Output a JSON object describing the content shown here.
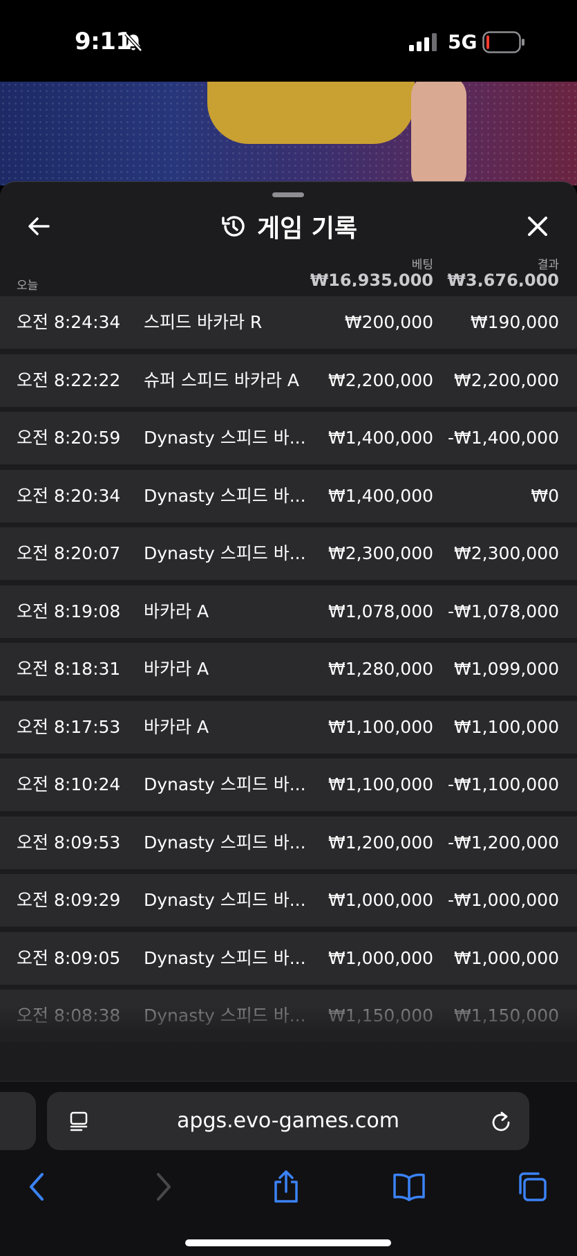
{
  "status_bar": {
    "time": "9:11",
    "network": "5G",
    "battery_level": 0.08,
    "battery_color": "#ff3b30"
  },
  "sheet": {
    "title": "게임 기록",
    "icons": {
      "back": "arrow-left-icon",
      "history": "history-clock-icon",
      "close": "close-x-icon"
    },
    "columns": {
      "bet": "베팅",
      "result": "결과"
    },
    "summary": {
      "label": "오늘",
      "total_bet": "₩16,935,000",
      "total_result": "₩3,676,000"
    },
    "rows": [
      {
        "time": "오전 8:24:34",
        "game": "스피드 바카라 R",
        "bet": "₩200,000",
        "result": "₩190,000"
      },
      {
        "time": "오전 8:22:22",
        "game": "슈퍼 스피드 바카라 A",
        "bet": "₩2,200,000",
        "result": "₩2,200,000"
      },
      {
        "time": "오전 8:20:59",
        "game": "Dynasty 스피드 바...",
        "bet": "₩1,400,000",
        "result": "-₩1,400,000"
      },
      {
        "time": "오전 8:20:34",
        "game": "Dynasty 스피드 바...",
        "bet": "₩1,400,000",
        "result": "₩0"
      },
      {
        "time": "오전 8:20:07",
        "game": "Dynasty 스피드 바...",
        "bet": "₩2,300,000",
        "result": "₩2,300,000"
      },
      {
        "time": "오전 8:19:08",
        "game": "바카라 A",
        "bet": "₩1,078,000",
        "result": "-₩1,078,000"
      },
      {
        "time": "오전 8:18:31",
        "game": "바카라 A",
        "bet": "₩1,280,000",
        "result": "₩1,099,000"
      },
      {
        "time": "오전 8:17:53",
        "game": "바카라 A",
        "bet": "₩1,100,000",
        "result": "₩1,100,000"
      },
      {
        "time": "오전 8:10:24",
        "game": "Dynasty 스피드 바...",
        "bet": "₩1,100,000",
        "result": "-₩1,100,000"
      },
      {
        "time": "오전 8:09:53",
        "game": "Dynasty 스피드 바...",
        "bet": "₩1,200,000",
        "result": "-₩1,200,000"
      },
      {
        "time": "오전 8:09:29",
        "game": "Dynasty 스피드 바...",
        "bet": "₩1,000,000",
        "result": "-₩1,000,000"
      },
      {
        "time": "오전 8:09:05",
        "game": "Dynasty 스피드 바...",
        "bet": "₩1,000,000",
        "result": "₩1,000,000"
      },
      {
        "time": "오전 8:08:38",
        "game": "Dynasty 스피드 바...",
        "bet": "₩1,150,000",
        "result": "₩1,150,000"
      }
    ]
  },
  "browser": {
    "url": "apgs.evo-games.com",
    "accent_color": "#3b82f6",
    "icons": [
      "reader-icon",
      "reload-icon",
      "back-icon",
      "forward-icon",
      "share-icon",
      "bookmarks-icon",
      "tabs-icon"
    ]
  }
}
